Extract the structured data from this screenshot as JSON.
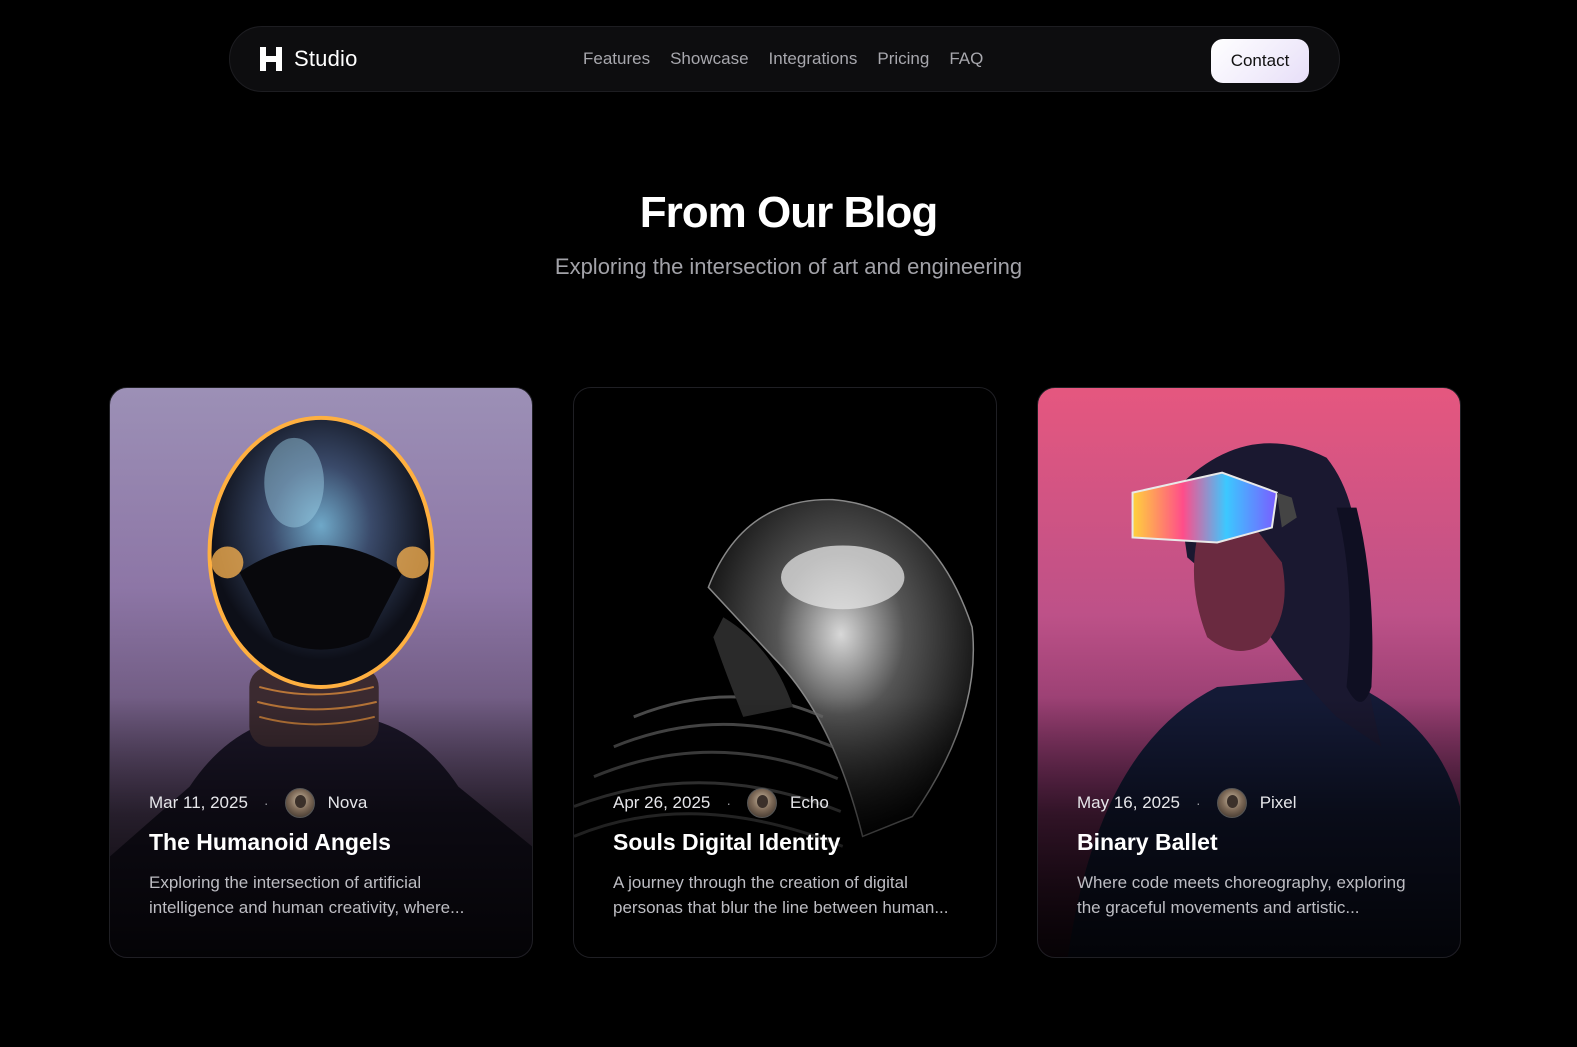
{
  "nav": {
    "brand": "Studio",
    "links": [
      "Features",
      "Showcase",
      "Integrations",
      "Pricing",
      "FAQ"
    ],
    "contact_label": "Contact"
  },
  "header": {
    "title": "From Our Blog",
    "subtitle": "Exploring the intersection of art and engineering"
  },
  "posts": [
    {
      "date": "Mar 11, 2025",
      "author": "Nova",
      "title": "The Humanoid Angels",
      "excerpt": "Exploring the intersection of artificial intelligence and human creativity, where..."
    },
    {
      "date": "Apr 26, 2025",
      "author": "Echo",
      "title": "Souls Digital Identity",
      "excerpt": "A journey through the creation of digital personas that blur the line between human..."
    },
    {
      "date": "May 16, 2025",
      "author": "Pixel",
      "title": "Binary Ballet",
      "excerpt": "Where code meets choreography, exploring the graceful movements and artistic..."
    }
  ]
}
